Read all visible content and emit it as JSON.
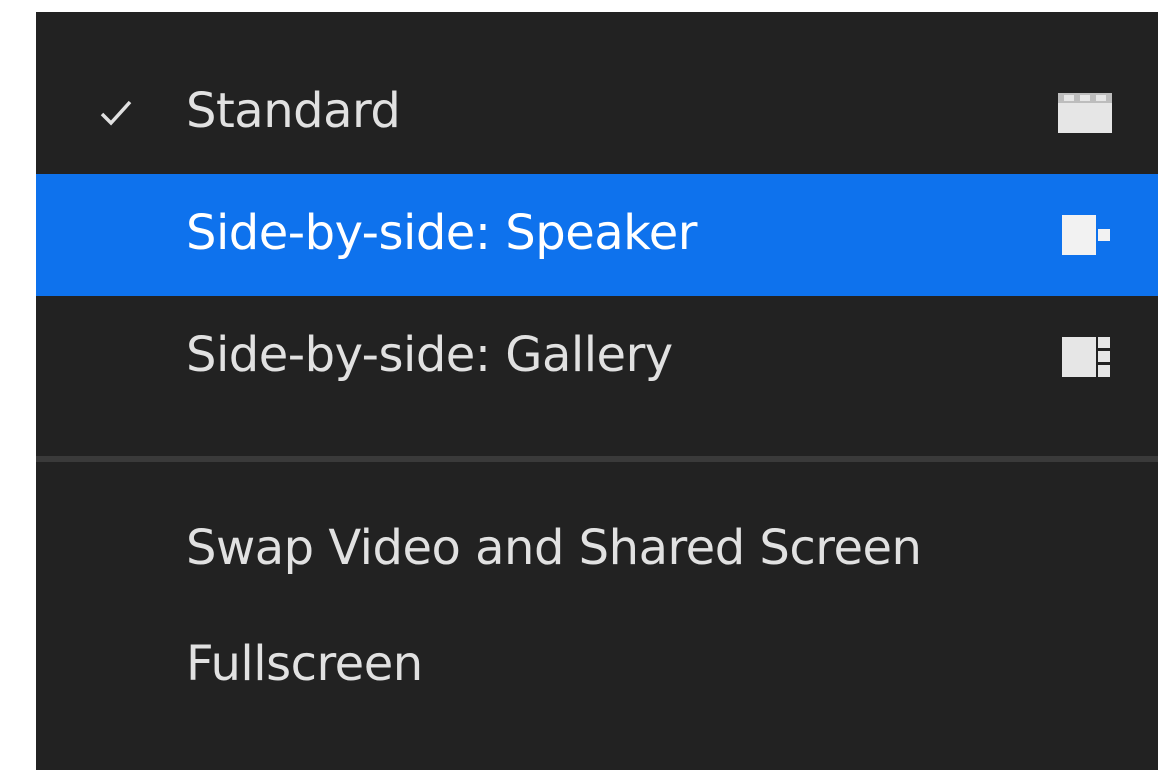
{
  "menu": {
    "layout_items": [
      {
        "label": "Standard",
        "checked": true,
        "highlighted": false,
        "icon": "standard-layout-icon"
      },
      {
        "label": "Side-by-side: Speaker",
        "checked": false,
        "highlighted": true,
        "icon": "side-by-side-speaker-icon"
      },
      {
        "label": "Side-by-side: Gallery",
        "checked": false,
        "highlighted": false,
        "icon": "side-by-side-gallery-icon"
      }
    ],
    "actions": [
      {
        "label": "Swap Video and Shared Screen"
      },
      {
        "label": "Fullscreen"
      }
    ]
  },
  "colors": {
    "menu_background": "#222222",
    "highlight": "#0e72ed",
    "text": "#e1e1e1",
    "divider": "#3a3a3a"
  }
}
